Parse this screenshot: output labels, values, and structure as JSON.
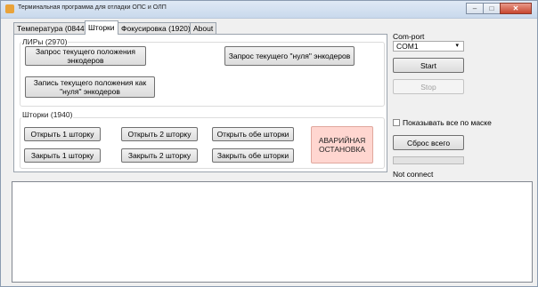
{
  "window": {
    "title": "Терминальная программа для отладки ОПС и ОЛП"
  },
  "tabs": [
    {
      "label": "Температура (0844)",
      "active": false
    },
    {
      "label": "Шторки",
      "active": true
    },
    {
      "label": "Фокусировка (1920)",
      "active": false
    },
    {
      "label": "About",
      "active": false
    }
  ],
  "lir_group": {
    "title": "ЛИРы (2970)",
    "request_position": "Запрос текущего положения энкодеров",
    "request_zero": "Запрос текущего \"нуля\" энкодеров",
    "write_zero": "Запись текущего положения как \"нуля\" энкодеров"
  },
  "shutters_group": {
    "title": "Шторки (1940)",
    "open1": "Открыть 1 шторку",
    "open2": "Открыть 2 шторку",
    "open_both": "Открыть обе шторки",
    "close1": "Закрыть 1 шторку",
    "close2": "Закрыть 2 шторку",
    "close_both": "Закрыть обе шторки",
    "emergency": "АВАРИЙНАЯ ОСТАНОВКА"
  },
  "side_panel": {
    "com_label": "Com-port",
    "com_value": "COM1",
    "start": "Start",
    "stop": "Stop",
    "mask_checkbox": "Показывать все по маске",
    "mask_checked": false,
    "reset": "Сброс всего",
    "progress": 0,
    "status": "Not connect"
  },
  "colors": {
    "emergency_bg": "#ffd6d0",
    "progress_fill": "#3aa63a"
  }
}
